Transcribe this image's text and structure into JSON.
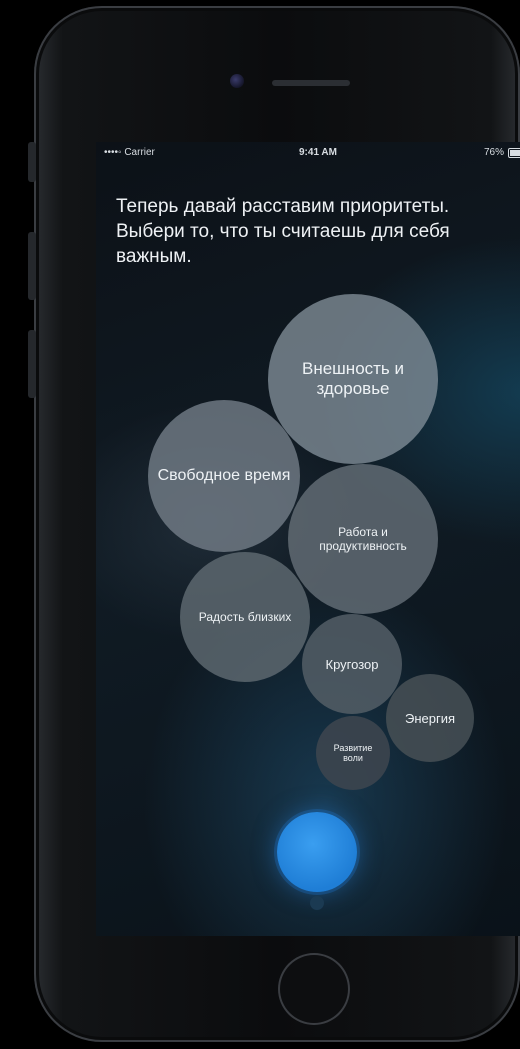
{
  "status_bar": {
    "carrier": "••••◦ Carrier",
    "time": "9:41 AM",
    "battery": "76%"
  },
  "prompt": "Теперь давай расставим приоритеты. Выбери то, что ты считаешь для себя важным.",
  "bubbles": [
    {
      "label": "Внешность и здоровье"
    },
    {
      "label": "Свободное время"
    },
    {
      "label": "Работа и продуктивность"
    },
    {
      "label": "Радость близких"
    },
    {
      "label": "Кругозор"
    },
    {
      "label": "Энергия"
    },
    {
      "label": "Развитие воли"
    }
  ],
  "colors": {
    "mic_button": "#2a8ae6",
    "bubble_fill": "#6f7e8a"
  },
  "icons": {
    "mic": "microphone-button",
    "home": "home-button"
  }
}
